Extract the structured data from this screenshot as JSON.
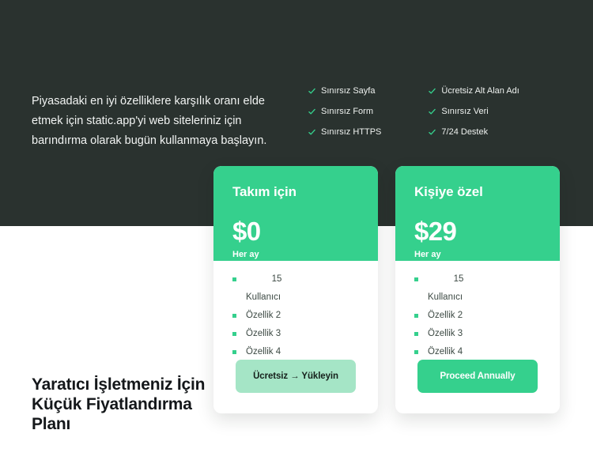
{
  "hero": {
    "intro": "Piyasadaki en iyi özelliklere karşılık oranı elde etmek için static.app'yi web siteleriniz için barındırma olarak bugün kullanmaya başlayın.",
    "background_color": "#2a322f"
  },
  "features": {
    "check_icon": "check-icon",
    "columns": [
      {
        "items": [
          "Sınırsız Sayfa",
          "Sınırsız Form",
          "Sınırsız HTTPS"
        ]
      },
      {
        "items": [
          "Ücretsiz Alt Alan Adı",
          "Sınırsız Veri",
          "7/24 Destek"
        ]
      }
    ]
  },
  "promo": {
    "heading": "Yaratıcı İşletmeniz İçin Küçük Fiyatlandırma Planı"
  },
  "theme": {
    "accent_green": "#35d08d",
    "mint": "#a5e5c6",
    "dark": "#2a322f"
  },
  "pricing": {
    "cards": [
      {
        "title": "Takım için",
        "price": "$0",
        "period": "Her ay",
        "features": [
          "15",
          "Kullanıcı",
          "Özellik 2",
          "Özellik 3",
          "Özellik 4"
        ],
        "cta_label": "Ücretsiz → Yükleyin"
      },
      {
        "title": "Kişiye özel",
        "price": "$29",
        "period": "Her ay",
        "features": [
          "15",
          "Kullanıcı",
          "Özellik 2",
          "Özellik 3",
          "Özellik 4"
        ],
        "cta_label": "Proceed Annually"
      }
    ]
  }
}
